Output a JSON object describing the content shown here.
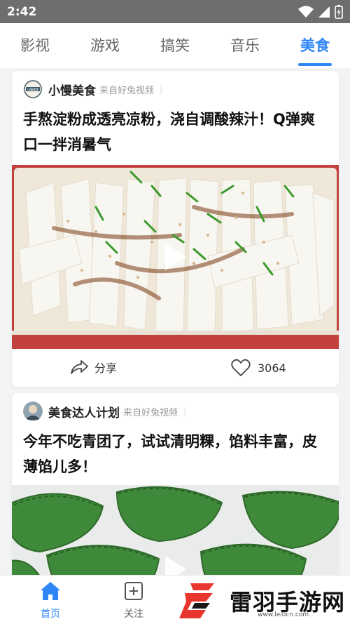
{
  "status_bar": {
    "time": "2:42"
  },
  "tabs": [
    {
      "label": "影视"
    },
    {
      "label": "游戏"
    },
    {
      "label": "搞笑"
    },
    {
      "label": "音乐"
    },
    {
      "label": "美食",
      "active": true
    }
  ],
  "feed": [
    {
      "author": "小慢美食",
      "avatar_text": "小慢美食",
      "source": "来自好兔视频",
      "title": "手熬淀粉成透亮凉粉，浇自调酸辣汁！Q弹爽口一拌消暑气",
      "share_label": "分享",
      "like_count": "3064"
    },
    {
      "author": "美食达人计划",
      "source": "来自好兔视频",
      "title": "今年不吃青团了，试试清明粿，馅料丰富，皮薄馅儿多！"
    }
  ],
  "bottom_nav": [
    {
      "label": "首页",
      "active": true
    },
    {
      "label": "关注"
    }
  ],
  "watermark": {
    "text": "雷羽手游网",
    "url": "www.leiucn.com"
  },
  "colors": {
    "accent": "#2f86f6"
  }
}
